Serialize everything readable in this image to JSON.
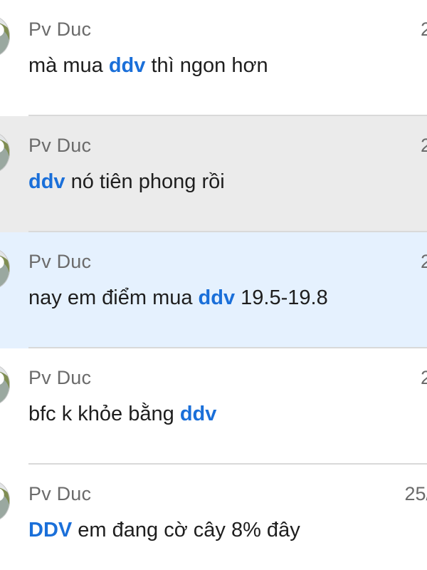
{
  "results": [
    {
      "sender": "Pv Duc",
      "date": "2",
      "state": "normal",
      "message": {
        "before": "mà mua ",
        "keyword": "ddv",
        "after": " thì ngon hơn"
      }
    },
    {
      "sender": "Pv Duc",
      "date": "2",
      "state": "hover",
      "message": {
        "before": "",
        "keyword": "ddv",
        "after": " nó tiên phong rồi"
      }
    },
    {
      "sender": "Pv Duc",
      "date": "2",
      "state": "selected",
      "message": {
        "before": "nay em điểm mua ",
        "keyword": "ddv",
        "after": " 19.5-19.8"
      }
    },
    {
      "sender": "Pv Duc",
      "date": "2",
      "state": "normal",
      "message": {
        "before": "bfc k khỏe bằng ",
        "keyword": "ddv",
        "after": ""
      }
    },
    {
      "sender": "Pv Duc",
      "date": "25/",
      "state": "normal",
      "message": {
        "before": "",
        "keyword": "DDV",
        "after": " em đang cờ cây 8% đây"
      }
    }
  ],
  "colors": {
    "keyword_highlight": "#1a6fd9",
    "hover_background": "#ebebeb",
    "selected_background": "#e5f1fe",
    "divider": "#d9d9d9"
  },
  "icons": {
    "avatar": "user-avatar-globe-icon"
  }
}
